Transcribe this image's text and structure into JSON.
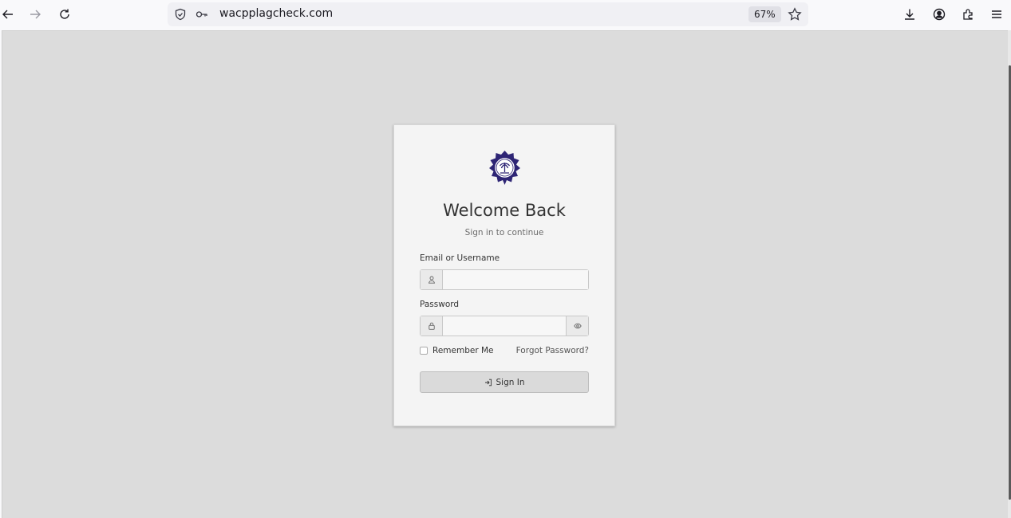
{
  "browser": {
    "url": "wacpplagcheck.com",
    "zoom": "67%",
    "icons": [
      "back-icon",
      "forward-icon",
      "reload-icon",
      "shield-icon",
      "key-icon",
      "bookmark-star-icon",
      "download-icon",
      "account-icon",
      "extensions-icon",
      "menu-icon"
    ]
  },
  "login": {
    "title": "Welcome Back",
    "subtitle": "Sign in to continue",
    "username_label": "Email or Username",
    "username_value": "",
    "password_label": "Password",
    "password_value": "",
    "remember_label": "Remember Me",
    "forgot_label": "Forgot Password?",
    "signin_label": "Sign In"
  },
  "colors": {
    "page_bg": "#dcdcdc",
    "card_bg": "#f4f4f4",
    "logo": "#2e2575"
  }
}
